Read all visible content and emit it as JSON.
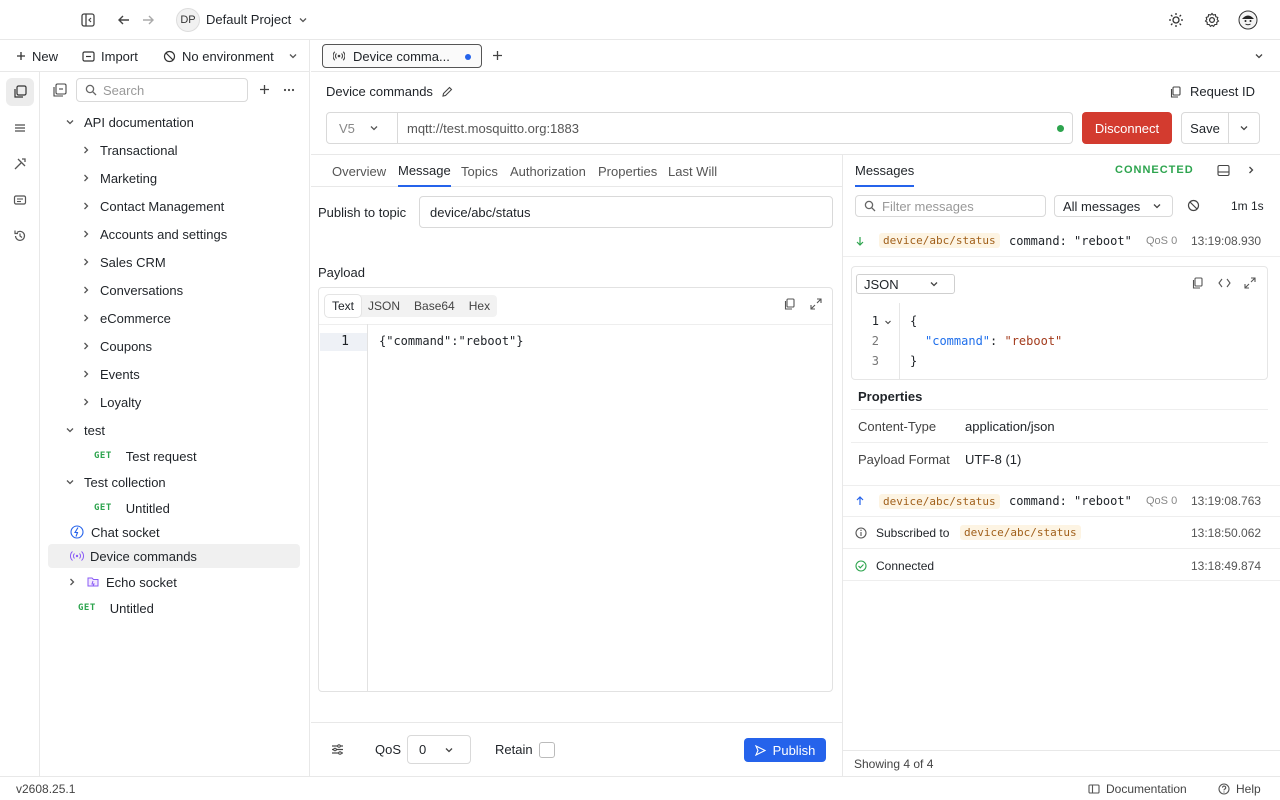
{
  "topbar": {
    "project_initials": "DP",
    "project_name": "Default Project"
  },
  "toolbar": {
    "new_label": "New",
    "import_label": "Import",
    "environment_label": "No environment"
  },
  "sidebar": {
    "search_placeholder": "Search",
    "tree": [
      {
        "label": "API documentation",
        "type": "folder-open"
      },
      {
        "label": "Transactional",
        "type": "folder"
      },
      {
        "label": "Marketing",
        "type": "folder"
      },
      {
        "label": "Contact Management",
        "type": "folder"
      },
      {
        "label": "Accounts and settings",
        "type": "folder"
      },
      {
        "label": "Sales CRM",
        "type": "folder"
      },
      {
        "label": "Conversations",
        "type": "folder"
      },
      {
        "label": "eCommerce",
        "type": "folder"
      },
      {
        "label": "Coupons",
        "type": "folder"
      },
      {
        "label": "Events",
        "type": "folder"
      },
      {
        "label": "Loyalty",
        "type": "folder"
      },
      {
        "label": "test",
        "type": "folder-open"
      },
      {
        "label": "Test request",
        "method": "GET"
      },
      {
        "label": "Test collection",
        "type": "folder-open"
      },
      {
        "label": "Untitled",
        "method": "GET"
      },
      {
        "label": "Chat socket",
        "type": "websocket"
      },
      {
        "label": "Device commands",
        "type": "mqtt"
      },
      {
        "label": "Echo socket",
        "type": "folder"
      },
      {
        "label": "Untitled",
        "method": "GET"
      }
    ]
  },
  "tabs": {
    "active_tab_label": "Device comma..."
  },
  "request": {
    "title": "Device commands",
    "request_id_label": "Request ID",
    "version": "V5",
    "url": "mqtt://test.mosquitto.org:1883",
    "disconnect_label": "Disconnect",
    "save_label": "Save"
  },
  "subtabs": [
    "Overview",
    "Message",
    "Topics",
    "Authorization",
    "Properties",
    "Last Will"
  ],
  "message": {
    "publish_label": "Publish to topic",
    "topic_value": "device/abc/status",
    "payload_label": "Payload",
    "editor_tabs": [
      "Text",
      "JSON",
      "Base64",
      "Hex"
    ],
    "line_number": "1",
    "code": "{\"command\":\"reboot\"}"
  },
  "publishbar": {
    "qos_label": "QoS",
    "qos_value": "0",
    "retain_label": "Retain",
    "publish_label": "Publish"
  },
  "messages": {
    "tab_label": "Messages",
    "status": "CONNECTED",
    "filter_placeholder": "Filter messages",
    "filter_select": "All messages",
    "elapsed": "1m 1s",
    "rows": [
      {
        "direction": "in",
        "topic": "device/abc/status",
        "text": "command: \"reboot\"",
        "qos": "QoS 0",
        "time": "13:19:08.930"
      },
      {
        "direction": "out",
        "topic": "device/abc/status",
        "text": "command: \"reboot\"",
        "qos": "QoS 0",
        "time": "13:19:08.763"
      }
    ],
    "detail": {
      "format": "JSON",
      "lines": [
        "1",
        "2",
        "3"
      ],
      "code_open": "{",
      "code_key": "\"command\"",
      "code_sep": ": ",
      "code_val": "\"reboot\"",
      "code_close": "}",
      "properties_title": "Properties",
      "props": [
        {
          "key": "Content-Type",
          "value": "application/json"
        },
        {
          "key": "Payload Format",
          "value": "UTF-8 (1)"
        }
      ]
    },
    "events": [
      {
        "label": "Subscribed to",
        "topic": "device/abc/status",
        "time": "13:18:50.062"
      },
      {
        "label": "Connected",
        "time": "13:18:49.874"
      }
    ],
    "showing": "Showing 4 of 4"
  },
  "footer": {
    "version": "v2608.25.1",
    "documentation_label": "Documentation",
    "help_label": "Help"
  },
  "colors": {
    "accent": "#2563eb",
    "danger": "#d33b2f",
    "success": "#2da44e"
  }
}
